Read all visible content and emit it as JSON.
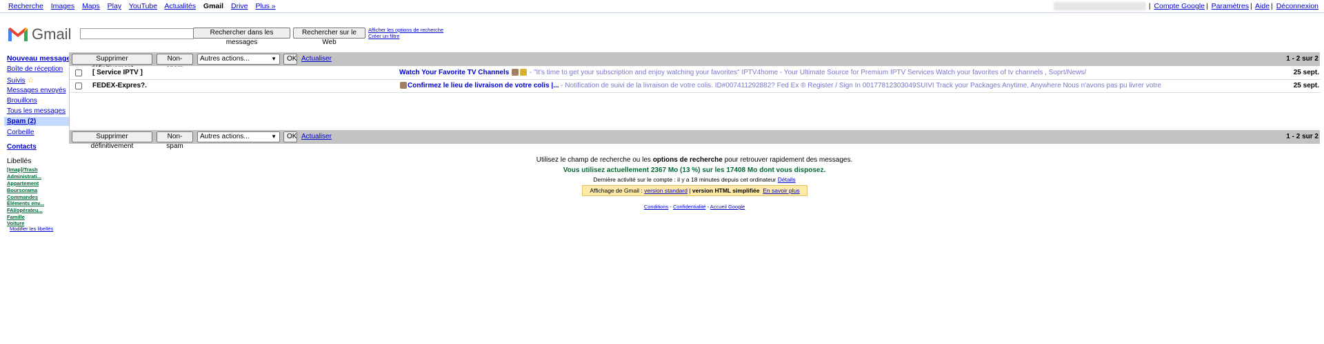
{
  "topbar": {
    "nav": [
      "Recherche",
      "Images",
      "Maps",
      "Play",
      "YouTube",
      "Actualités",
      "Gmail",
      "Drive",
      "Plus »"
    ],
    "right": [
      "Compte Google",
      "Paramètres",
      "Aide",
      "Déconnexion"
    ]
  },
  "header": {
    "logo_text": "Gmail",
    "search_value": "",
    "btn_search_mail": "Rechercher dans les messages",
    "btn_search_web": "Rechercher sur le Web",
    "link_show_options": "Afficher les options de recherche",
    "link_create_filter": "Créer un filtre"
  },
  "sidebar": {
    "compose": "Nouveau message",
    "items": [
      "Boîte de réception",
      "Suivis",
      "Messages envoyés",
      "Brouillons",
      "Tous les messages",
      "Spam (2)",
      "Corbeille"
    ],
    "contacts": "Contacts",
    "labels_title": "Libellés",
    "labels": [
      "[Imap]/Trash",
      "Administrati...",
      "Appartement",
      "Boursorama",
      "Commandes",
      "Éléments env...",
      "FAI/opérateu...",
      "Famille",
      "Voiture"
    ],
    "edit_labels": "Modifier les libellés"
  },
  "toolbar": {
    "delete": "Supprimer définitivement",
    "not_spam": "Non-spam",
    "more_actions": "Autres actions...",
    "ok": "OK",
    "refresh": "Actualiser",
    "count": "1 - 2 sur 2"
  },
  "messages": [
    {
      "sender": "[ Service IPTV ]",
      "subject": "Watch Your Favorite TV Channels",
      "snippet": " - \"It's time to get your subscription and enjoy watching your favorites\" IPTV4home - Your Ultimate Source for Premium IPTV Services Watch your favorites of tv channels , Soprt/News/",
      "date": "25 sept."
    },
    {
      "sender": "FEDEX-Expres?.",
      "subject": "Confirmez le lieu de livraison de votre colis |...",
      "snippet": " - Notification de suivi de la livraison de votre colis. ID#007411292882? Fed Ex ® Register / Sign In 00177812303049SUIVI Track your Packages Anytime, Anywhere Nous n'avons pas pu livrer votre",
      "date": "25 sept."
    }
  ],
  "footer": {
    "tip_pre": "Utilisez le champ de recherche ou les ",
    "tip_bold": "options de recherche",
    "tip_post": " pour retrouver rapidement des messages.",
    "usage": "Vous utilisez actuellement 2367 Mo (13 %) sur les 17408 Mo dont vous disposez.",
    "activity": "Dernière activité sur le compte : il y a 18 minutes depuis cet ordinateur",
    "details": "Détails",
    "view_label": "Affichage de Gmail : ",
    "view_standard": "version standard",
    "view_sep": " | ",
    "view_html": "version HTML simplifiée",
    "view_learn": "En savoir plus",
    "links": [
      "Conditions",
      "Confidentialité",
      "Accueil Google"
    ]
  },
  "colors": {
    "link": "#0000cc",
    "label": "#006633",
    "spam_highlight": "#c3d9ff",
    "actionbar": "#c3c3c3"
  }
}
